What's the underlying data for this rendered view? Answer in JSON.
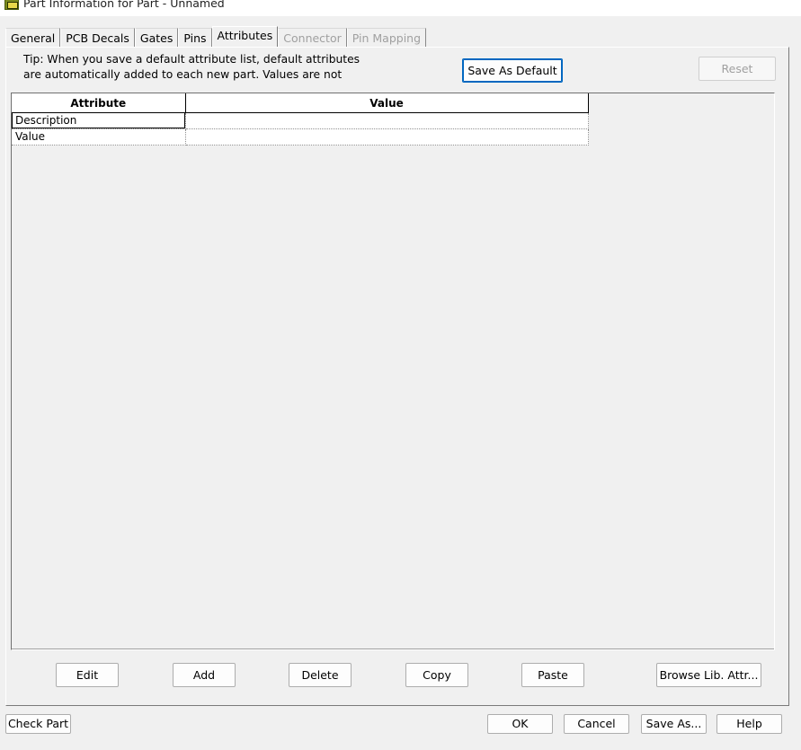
{
  "window": {
    "title": "Part Information for Part - Unnamed",
    "icon": "pcb-part-icon"
  },
  "tabs": [
    {
      "label": "General",
      "active": false,
      "enabled": true
    },
    {
      "label": "PCB Decals",
      "active": false,
      "enabled": true
    },
    {
      "label": "Gates",
      "active": false,
      "enabled": true
    },
    {
      "label": "Pins",
      "active": false,
      "enabled": true
    },
    {
      "label": "Attributes",
      "active": true,
      "enabled": true
    },
    {
      "label": "Connector",
      "active": false,
      "enabled": false
    },
    {
      "label": "Pin Mapping",
      "active": false,
      "enabled": false
    }
  ],
  "tip": {
    "line1": "Tip: When you save a default attribute list, default attributes",
    "line2": "are automatically added to each new part. Values are not"
  },
  "top_buttons": {
    "save_default": "Save As Default",
    "reset": "Reset"
  },
  "grid": {
    "headers": {
      "attribute": "Attribute",
      "value": "Value"
    },
    "rows": [
      {
        "attribute": "Description",
        "value": ""
      },
      {
        "attribute": "Value",
        "value": ""
      }
    ]
  },
  "grid_buttons": {
    "edit": "Edit",
    "add": "Add",
    "delete": "Delete",
    "copy": "Copy",
    "paste": "Paste",
    "browse": "Browse Lib. Attr..."
  },
  "dialog_buttons": {
    "check_part": "Check Part",
    "ok": "OK",
    "cancel": "Cancel",
    "save_as": "Save As...",
    "help": "Help"
  },
  "colors": {
    "focus_border": "#0067c0",
    "disabled_text": "#a0a0a0",
    "window_bg": "#f0f0f0"
  }
}
